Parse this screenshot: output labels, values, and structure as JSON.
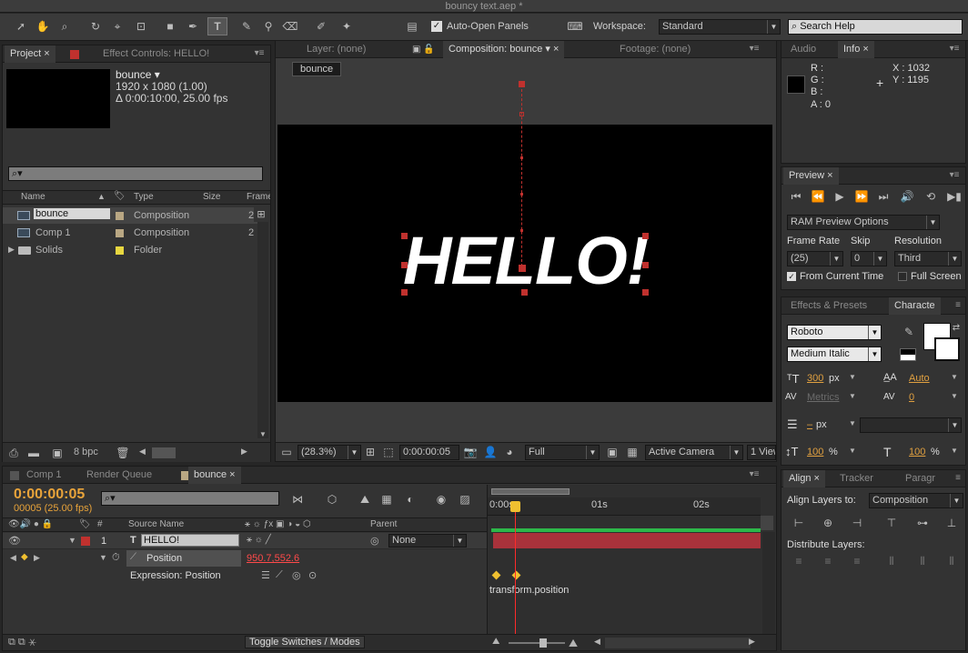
{
  "window": {
    "title": "bouncy text.aep *"
  },
  "toolbar": {
    "auto_open_label": "Auto-Open Panels",
    "workspace_label": "Workspace:",
    "workspace_value": "Standard",
    "search_placeholder": "Search Help"
  },
  "project_panel": {
    "tabs": [
      "Project",
      "Effect Controls: HELLO!"
    ],
    "comp_name": "bounce ▾",
    "comp_dims": "1920 x 1080 (1.00)",
    "comp_duration": "Δ 0:00:10:00, 25.00 fps",
    "search_icon": "⌕▾",
    "columns": [
      "Name",
      "Type",
      "Size",
      "Frame"
    ],
    "items": [
      {
        "name": "bounce",
        "type": "Composition",
        "size": "2",
        "color": "#b9a783",
        "icon": "composition-icon"
      },
      {
        "name": "Comp 1",
        "type": "Composition",
        "size": "2",
        "color": "#b9a783",
        "icon": "composition-icon"
      },
      {
        "name": "Solids",
        "type": "Folder",
        "size": "",
        "color": "#e8d740",
        "icon": "folder-icon"
      }
    ],
    "bpc": "8 bpc"
  },
  "viewer": {
    "tabs": [
      "Layer: (none)",
      "Composition: bounce",
      "Footage: (none)"
    ],
    "breadcrumb": "bounce",
    "text": "HELLO!",
    "zoom": "(28.3%)",
    "timecode": "0:00:00:05",
    "resolution": "Full",
    "camera": "Active Camera",
    "views": "1 View"
  },
  "info_panel": {
    "tabs": [
      "Audio",
      "Info"
    ],
    "r": "R :",
    "g": "G :",
    "b": "B :",
    "a": "A : 0",
    "x": "X : 1032",
    "y": "Y : 1195"
  },
  "preview_panel": {
    "tab": "Preview",
    "ram_preview": "RAM Preview Options",
    "frame_rate_label": "Frame Rate",
    "skip_label": "Skip",
    "resolution_label": "Resolution",
    "frame_rate": "(25)",
    "skip": "0",
    "resolution": "Third",
    "from_current": "From Current Time",
    "full_screen": "Full Screen"
  },
  "character_panel": {
    "tabs": [
      "Effects & Presets",
      "Characte"
    ],
    "font": "Roboto",
    "style": "Medium Italic",
    "size": "300",
    "size_unit": "px",
    "leading": "Auto",
    "kerning": "Metrics",
    "tracking": "0",
    "stroke_width": "–",
    "stroke_unit": "px",
    "vscale": "100",
    "hscale": "100",
    "pct": "%"
  },
  "align_panel": {
    "tabs": [
      "Align",
      "Tracker",
      "Paragr"
    ],
    "align_to_label": "Align Layers to:",
    "align_to": "Composition",
    "distribute_label": "Distribute Layers:"
  },
  "timeline": {
    "tabs": [
      "Comp 1",
      "Render Queue",
      "bounce"
    ],
    "timecode": "0:00:00:05",
    "frame_info": "00005 (25.00 fps)",
    "col_source": "Source Name",
    "col_parent": "Parent",
    "col_hash": "#",
    "layer_num": "1",
    "layer_name": "HELLO!",
    "parent_value": "None",
    "position_label": "Position",
    "position_value": "950.7,552.6",
    "expression_label": "Expression: Position",
    "expression_text": "transform.position",
    "ruler": [
      "0:00s",
      "01s",
      "02s"
    ],
    "toggle_label": "Toggle Switches / Modes"
  },
  "colors": {
    "accent": "#e8a33a",
    "handle": "#c0312e",
    "layer_bar": "#a8323b",
    "work_area": "#2db84a"
  }
}
